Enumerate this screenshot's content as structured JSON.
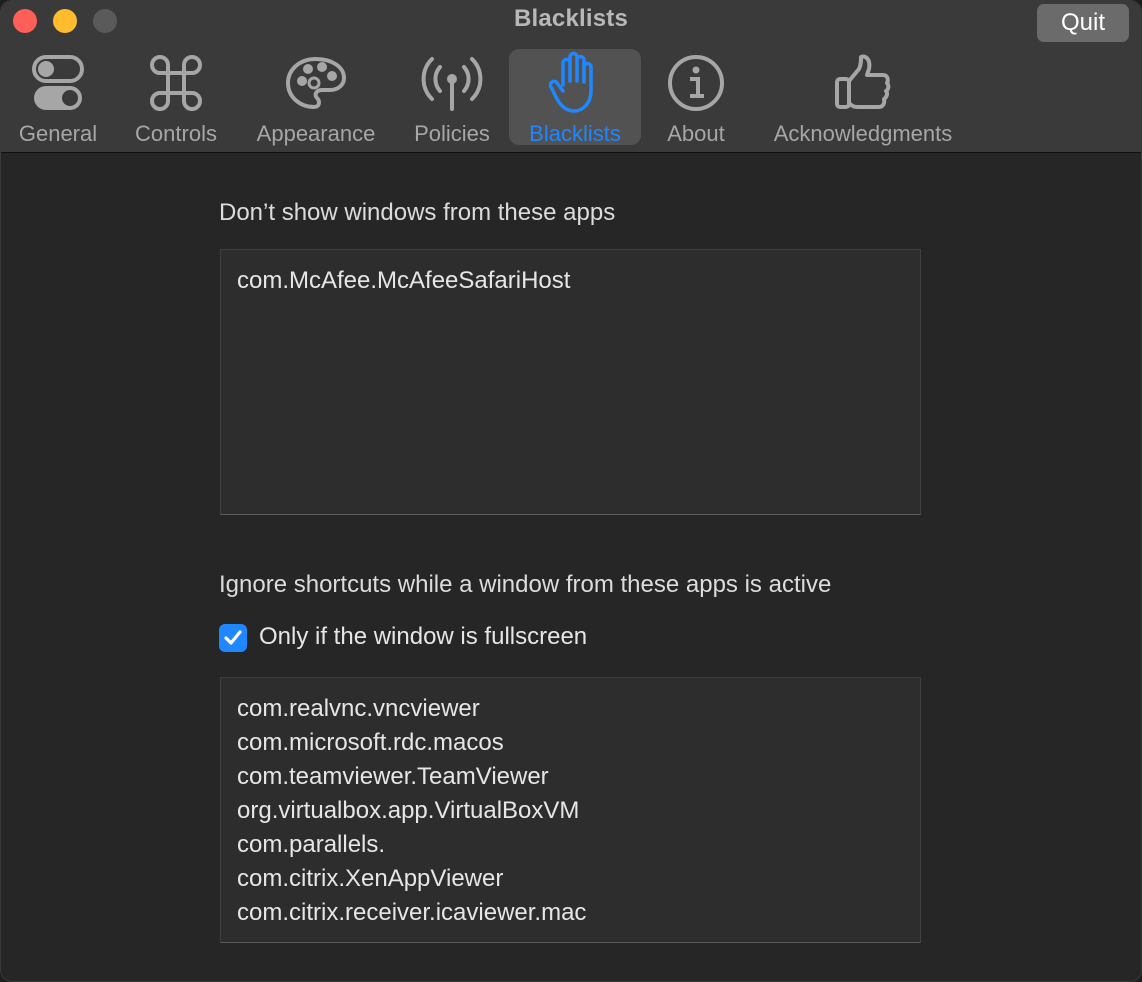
{
  "window": {
    "title": "Blacklists",
    "quit_label": "Quit"
  },
  "tabs": [
    {
      "label": "General",
      "icon": "toggles-icon"
    },
    {
      "label": "Controls",
      "icon": "command-key-icon"
    },
    {
      "label": "Appearance",
      "icon": "palette-icon"
    },
    {
      "label": "Policies",
      "icon": "antenna-icon"
    },
    {
      "label": "Blacklists",
      "icon": "hand-raised-icon",
      "selected": true
    },
    {
      "label": "About",
      "icon": "info-icon"
    },
    {
      "label": "Acknowledgments",
      "icon": "thumbs-up-icon"
    }
  ],
  "blacklists": {
    "hide_windows_label": "Don’t show windows from these apps",
    "hide_windows_apps": [
      "com.McAfee.McAfeeSafariHost"
    ],
    "ignore_shortcuts_label": "Ignore shortcuts while a window from these apps is active",
    "fullscreen_only_label": "Only if the window is fullscreen",
    "fullscreen_only_checked": true,
    "ignore_shortcuts_apps": [
      "com.realvnc.vncviewer",
      "com.microsoft.rdc.macos",
      "com.teamviewer.TeamViewer",
      "org.virtualbox.app.VirtualBoxVM",
      "com.parallels.",
      "com.citrix.XenAppViewer",
      "com.citrix.receiver.icaviewer.mac"
    ]
  },
  "colors": {
    "accent": "#1f87ff",
    "window_background": "#262626",
    "toolbar_background": "#3a3a3a",
    "close": "#fe5f57",
    "minimize": "#febc2e"
  }
}
